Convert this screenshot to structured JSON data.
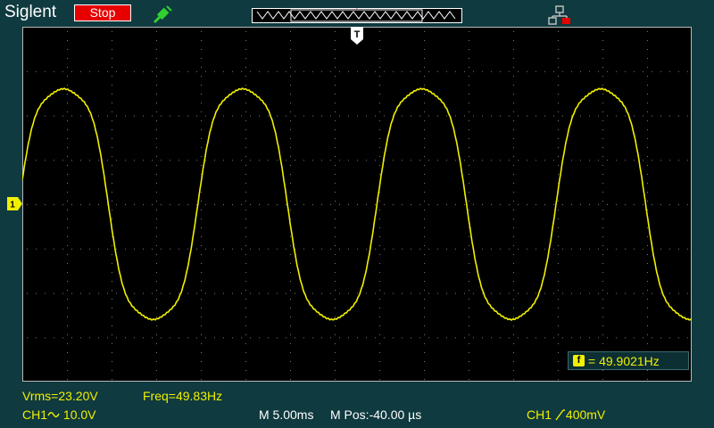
{
  "header": {
    "brand": "Siglent",
    "run_status": "Stop",
    "trigger_position_marker": "T"
  },
  "markers": {
    "ch1_marker": "1",
    "trigger_marker": "T"
  },
  "freq_counter": {
    "badge": "f",
    "text": "= 49.9021Hz"
  },
  "measurements": {
    "vrms": "Vrms=23.20V",
    "freq": "Freq=49.83Hz"
  },
  "status_bar": {
    "ch1_label": "CH1",
    "ch1_coupling_icon": "ac-coupling-icon",
    "ch1_scale": "10.0V",
    "timebase": "M 5.00ms",
    "position": "M Pos:-40.00 µs",
    "trigger_source": "CH1",
    "trigger_slope_icon": "rising-edge-icon",
    "trigger_level": "400mV"
  },
  "colors": {
    "background": "#0f3a3f",
    "screen": "#000000",
    "trace": "#f0f000",
    "stop": "#e60000",
    "grid_dots": "#7a7a7a"
  },
  "waveform": {
    "frequency_hz": 49.83,
    "vrms_v": 23.2,
    "volts_per_div": 10.0,
    "time_per_div_ms": 5.0
  }
}
